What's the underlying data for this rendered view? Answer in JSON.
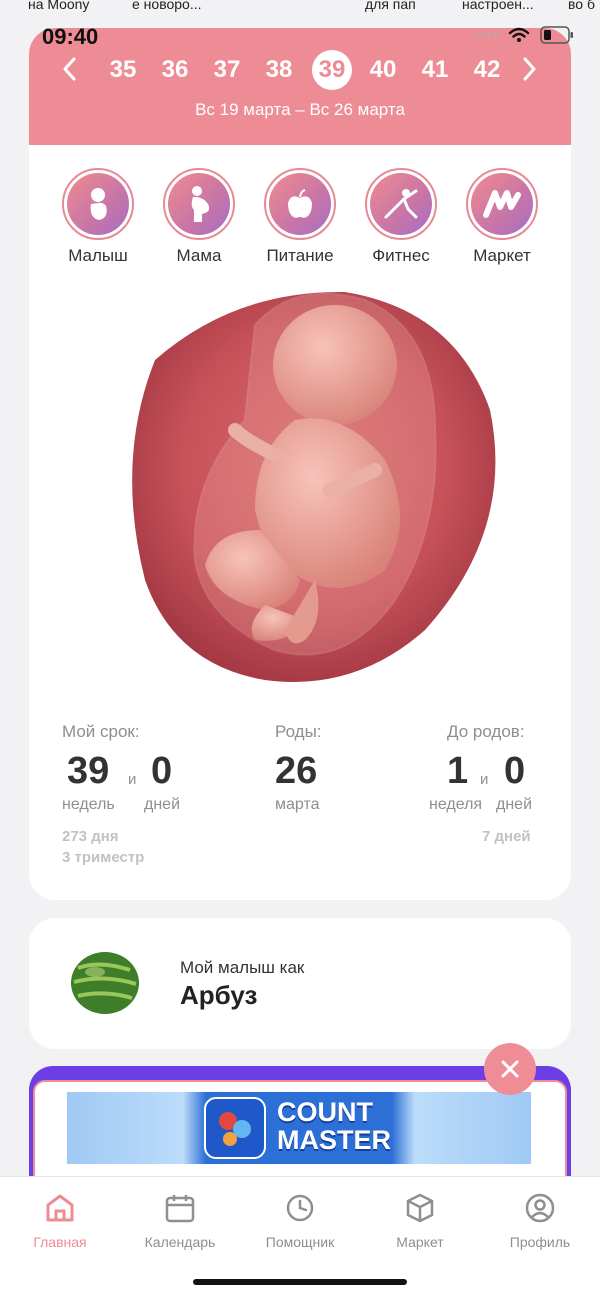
{
  "top_cut": [
    "на Moony",
    "е новоро...",
    "для пап",
    "настроен...",
    "во б"
  ],
  "status": {
    "time": "09:40"
  },
  "weeks": {
    "items": [
      "35",
      "36",
      "37",
      "38",
      "39",
      "40",
      "41",
      "42"
    ],
    "current": "39",
    "range": "Вс 19 марта – Вс 26 марта"
  },
  "categories": [
    "Малыш",
    "Мама",
    "Питание",
    "Фитнес",
    "Маркет"
  ],
  "stats": {
    "my_term": {
      "label": "Мой срок:",
      "weeks": "39",
      "and": "и",
      "days": "0",
      "weeks_unit": "недель",
      "days_unit": "дней",
      "total_days": "273 дня",
      "trimester": "3 триместр"
    },
    "birth": {
      "label": "Роды:",
      "day": "26",
      "month": "марта"
    },
    "until": {
      "label": "До родов:",
      "weeks": "1",
      "and": "и",
      "days": "0",
      "weeks_unit": "неделя",
      "days_unit": "дней",
      "total_days": "7 дней"
    }
  },
  "baby_size": {
    "title": "Мой малыш как",
    "fruit": "Арбуз"
  },
  "ad": {
    "line1": "COUNT",
    "line2": "MASTER"
  },
  "tabs": [
    "Главная",
    "Календарь",
    "Помощник",
    "Маркет",
    "Профиль"
  ],
  "colors": {
    "accent": "#ee8c96",
    "ad_purple": "#6b3ee6"
  }
}
